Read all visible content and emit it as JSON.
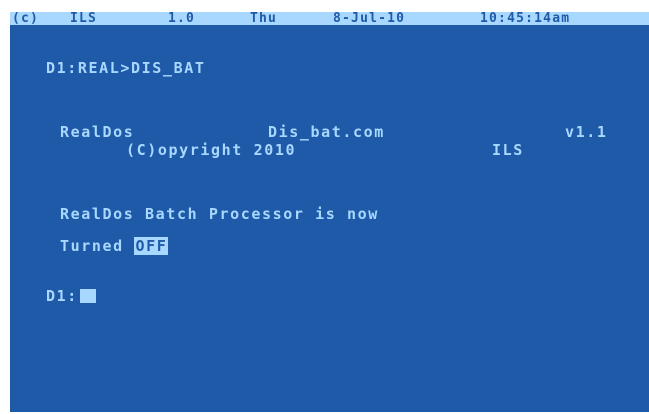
{
  "status_bar": {
    "copyright": "(c)",
    "product": "ILS",
    "version": "1.0",
    "day": "Thu",
    "date": "8-Jul-10",
    "time": "10:45:14am"
  },
  "console": {
    "command_prompt": "D1:REAL>",
    "command": "DIS_BAT",
    "banner_product": "RealDos",
    "banner_file": "Dis_bat.com",
    "banner_version": "v1.1",
    "banner_copyright": "(C)opyright 2010",
    "banner_company": "ILS",
    "message_line1": "RealDos Batch Processor is now",
    "message_line2_prefix": "Turned",
    "message_state": "OFF",
    "current_prompt": "D1:"
  },
  "colors": {
    "background": "#1e5aa8",
    "foreground": "#a8d8ff",
    "frame": "#ffffff"
  }
}
